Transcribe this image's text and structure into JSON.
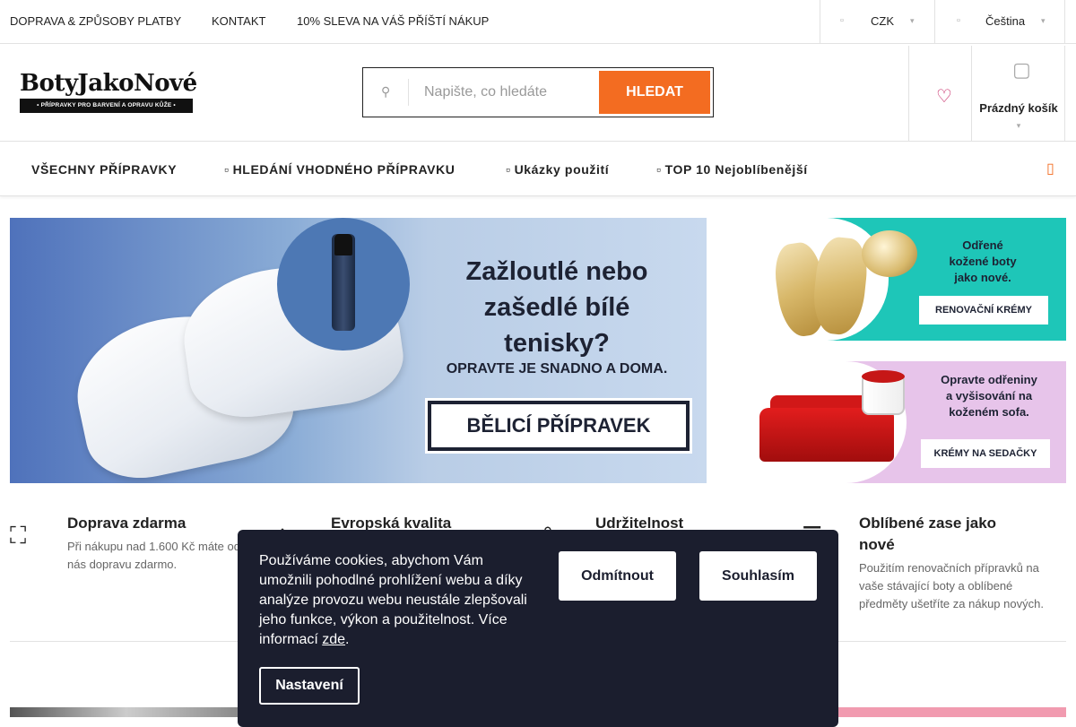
{
  "topbar": {
    "links": [
      "DOPRAVA & ZPŮSOBY PLATBY",
      "KONTAKT",
      "10% SLEVA NA VÁŠ PŘÍŠTÍ NÁKUP"
    ],
    "currency": "CZK",
    "language": "Čeština"
  },
  "header": {
    "logo_name": "BotyJakoNové",
    "logo_tagline": "• PŘÍPRAVKY PRO BARVENÍ A OPRAVU KŮŽE •",
    "search_placeholder": "Napište, co hledáte",
    "search_button": "HLEDAT",
    "cart_label": "Prázdný košík"
  },
  "nav": {
    "items": [
      "VŠECHNY PŘÍPRAVKY",
      "HLEDÁNÍ VHODNÉHO PŘÍPRAVKU",
      "Ukázky použití",
      "TOP 10 Nejoblíbenější"
    ]
  },
  "banners": {
    "main": {
      "title_line1": "Zažloutlé nebo",
      "title_line2": "zašedlé bílé",
      "title_line3": "tenisky?",
      "subtitle": "OPRAVTE JE SNADNO A DOMA.",
      "button": "BĚLICÍ PŘÍPRAVEK"
    },
    "side_a": {
      "title_line1": "Odřené",
      "title_line2": "kožené boty",
      "title_line3": "jako nové.",
      "button": "RENOVAČNÍ KRÉMY"
    },
    "side_b": {
      "title_line1": "Opravte odřeniny",
      "title_line2": "a vyšisování na",
      "title_line3": "koženém sofa.",
      "button": "KRÉMY NA SEDAČKY"
    }
  },
  "benefits": [
    {
      "title": "Doprava zdarma",
      "desc": "Při nákupu nad 1.600 Kč máte od nás dopravu zdarmo."
    },
    {
      "title": "Evropská kvalita",
      "desc": ""
    },
    {
      "title": "Udržitelnost",
      "desc": ""
    },
    {
      "title": "Oblíbené zase jako nové",
      "desc": "Použitím renovačních přípravků na vaše stávající boty a oblíbené předměty ušetříte za nákup nových."
    }
  ],
  "cookie": {
    "text": "Používáme cookies, abychom Vám umožnili pohodlné prohlížení webu a díky analýze provozu webu neustále zlepšovali jeho funkce, výkon a použitelnost. Více informací",
    "link": "zde",
    "after_link": ".",
    "decline": "Odmítnout",
    "accept": "Souhlasím",
    "settings": "Nastavení"
  },
  "colors": {
    "accent": "#f36c21",
    "favorite": "#c2185b",
    "cookie_bg": "#1b1e2e"
  },
  "icons": {
    "search": "search-icon",
    "favorite": "heart-icon",
    "cart": "cart-icon",
    "delivery": "truck-icon",
    "quality": "diamond-icon",
    "sustainability": "leaf-icon",
    "renew": "renew-icon"
  }
}
